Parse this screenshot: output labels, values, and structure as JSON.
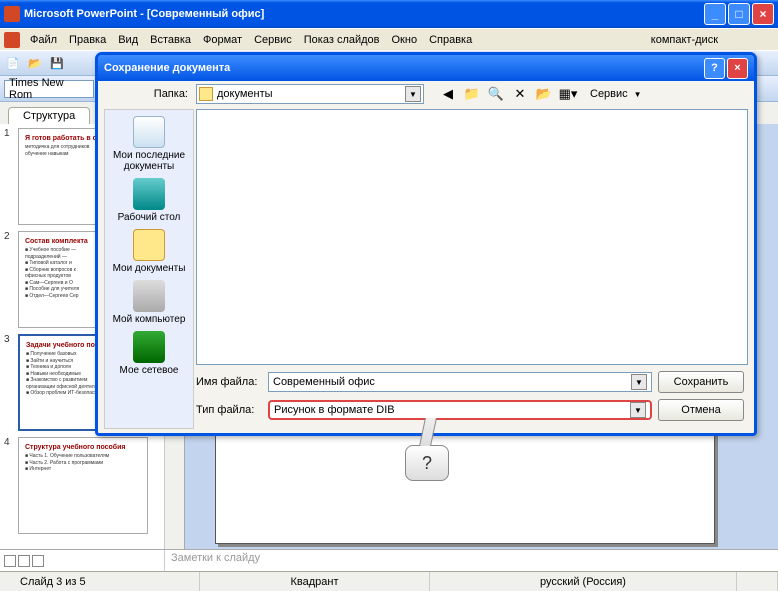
{
  "app_title": "Microsoft PowerPoint - [Современный офис]",
  "menu": [
    "Файл",
    "Правка",
    "Вид",
    "Вставка",
    "Формат",
    "Сервис",
    "Показ слайдов",
    "Окно",
    "Справка"
  ],
  "menu_right": "компакт-диск",
  "font_name": "Times New Rom",
  "tab_label": "Структура",
  "thumbs": [
    {
      "num": "1",
      "title": "Я готов работать в современном",
      "lines": [
        "методичка для сотрудников",
        "обучение навыкам"
      ]
    },
    {
      "num": "2",
      "title": "Состав комплекта",
      "lines": [
        "■ Учебное пособие —",
        "подразделений —",
        "■ Типовой каталог и",
        "■ Сборник вопросов к",
        "офисных продуктов",
        "■ Сам—Сергеев и О",
        "■ Пособие для учителя",
        "■ Отдел—Сергеев Сер"
      ]
    },
    {
      "num": "3",
      "title": "Задачи учебного по",
      "lines": [
        "■ Получение базовых",
        "■ Зайти и научиться",
        "■ Техника и дополн",
        "■ Навыки необходимые",
        "■ Знакомство с развитием",
        "организации офисной деятельности",
        "■ Обзор проблем ИТ-безопасности"
      ]
    },
    {
      "num": "4",
      "title": "Структура учебного пособия",
      "lines": [
        "■ Часть 1. Обучение пользователям",
        "■ Часть 2. Работа с программами",
        "■ Интернет"
      ]
    }
  ],
  "notes_placeholder": "Заметки к слайду",
  "status": {
    "slide": "Слайд 3 из 5",
    "layout": "Квадрант",
    "lang": "русский (Россия)"
  },
  "dialog": {
    "title": "Сохранение документа",
    "folder_label": "Папка:",
    "folder_value": "документы",
    "service_label": "Сервис",
    "places": [
      {
        "icon": "recent",
        "label": "Мои последние документы"
      },
      {
        "icon": "desktop",
        "label": "Рабочий стол"
      },
      {
        "icon": "mydocs",
        "label": "Мои документы"
      },
      {
        "icon": "comp",
        "label": "Мой компьютер"
      },
      {
        "icon": "net",
        "label": "Мое сетевое"
      }
    ],
    "filename_label": "Имя файла:",
    "filename_value": "Современный офис",
    "filetype_label": "Тип файла:",
    "filetype_value": "Рисунок в формате DIB",
    "save_btn": "Сохранить",
    "cancel_btn": "Отмена"
  },
  "callout_text": "?"
}
